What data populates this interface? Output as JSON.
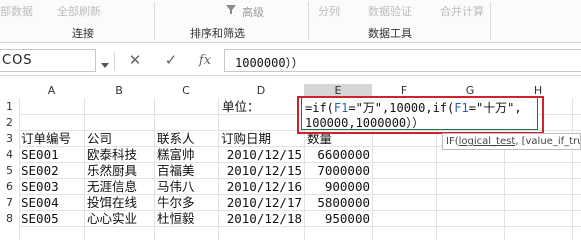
{
  "ribbon": {
    "faint_labels": [
      "部数据",
      "全部刷新",
      "高级",
      "分列",
      "数据验证",
      "合并计算"
    ],
    "advanced_label": "高级",
    "groups": [
      "连接",
      "排序和筛选",
      "数据工具"
    ]
  },
  "formula_bar": {
    "name_box": "COS",
    "cancel_icon": "✕",
    "enter_icon": "✓",
    "fx_label": "fx",
    "formula_text": "1000000））"
  },
  "columns": [
    "A",
    "B",
    "C",
    "D",
    "E",
    "F",
    "G",
    "H"
  ],
  "rows": [
    "1",
    "2",
    "3",
    "4",
    "5",
    "6",
    "7",
    "8"
  ],
  "cells": {
    "d1": "单位：",
    "headers": [
      "订单编号",
      "公司",
      "联系人",
      "订购日期",
      "数量"
    ],
    "data": [
      [
        "SE001",
        "欧泰科技",
        "糕富帅",
        "2010/12/15",
        "6600000"
      ],
      [
        "SE002",
        "乐然厨具",
        "百福美",
        "2010/12/15",
        "7000000"
      ],
      [
        "SE003",
        "无涯信息",
        "马伟八",
        "2010/12/16",
        "900000"
      ],
      [
        "SE004",
        "投饵在线",
        "牛尔多",
        "2010/12/17",
        "5800000"
      ],
      [
        "SE005",
        "心心实业",
        "杜恒毅",
        "2010/12/18",
        "950000"
      ]
    ]
  },
  "editor": {
    "line1_prefix": "=if(",
    "line1_ref1": "F1",
    "line1_mid": "=\"万\",10000,if(",
    "line1_ref2": "F1",
    "line1_suffix": "=\"十万\",",
    "line2": "100000,1000000））"
  },
  "tooltip": {
    "func": "IF(",
    "arg1": "logical_test",
    "rest": ", [value_if_true], [value_if_false])"
  },
  "colors": {
    "excel_green": "#217346",
    "highlight_red": "#d0212d",
    "ref_blue": "#2e5fb3"
  }
}
